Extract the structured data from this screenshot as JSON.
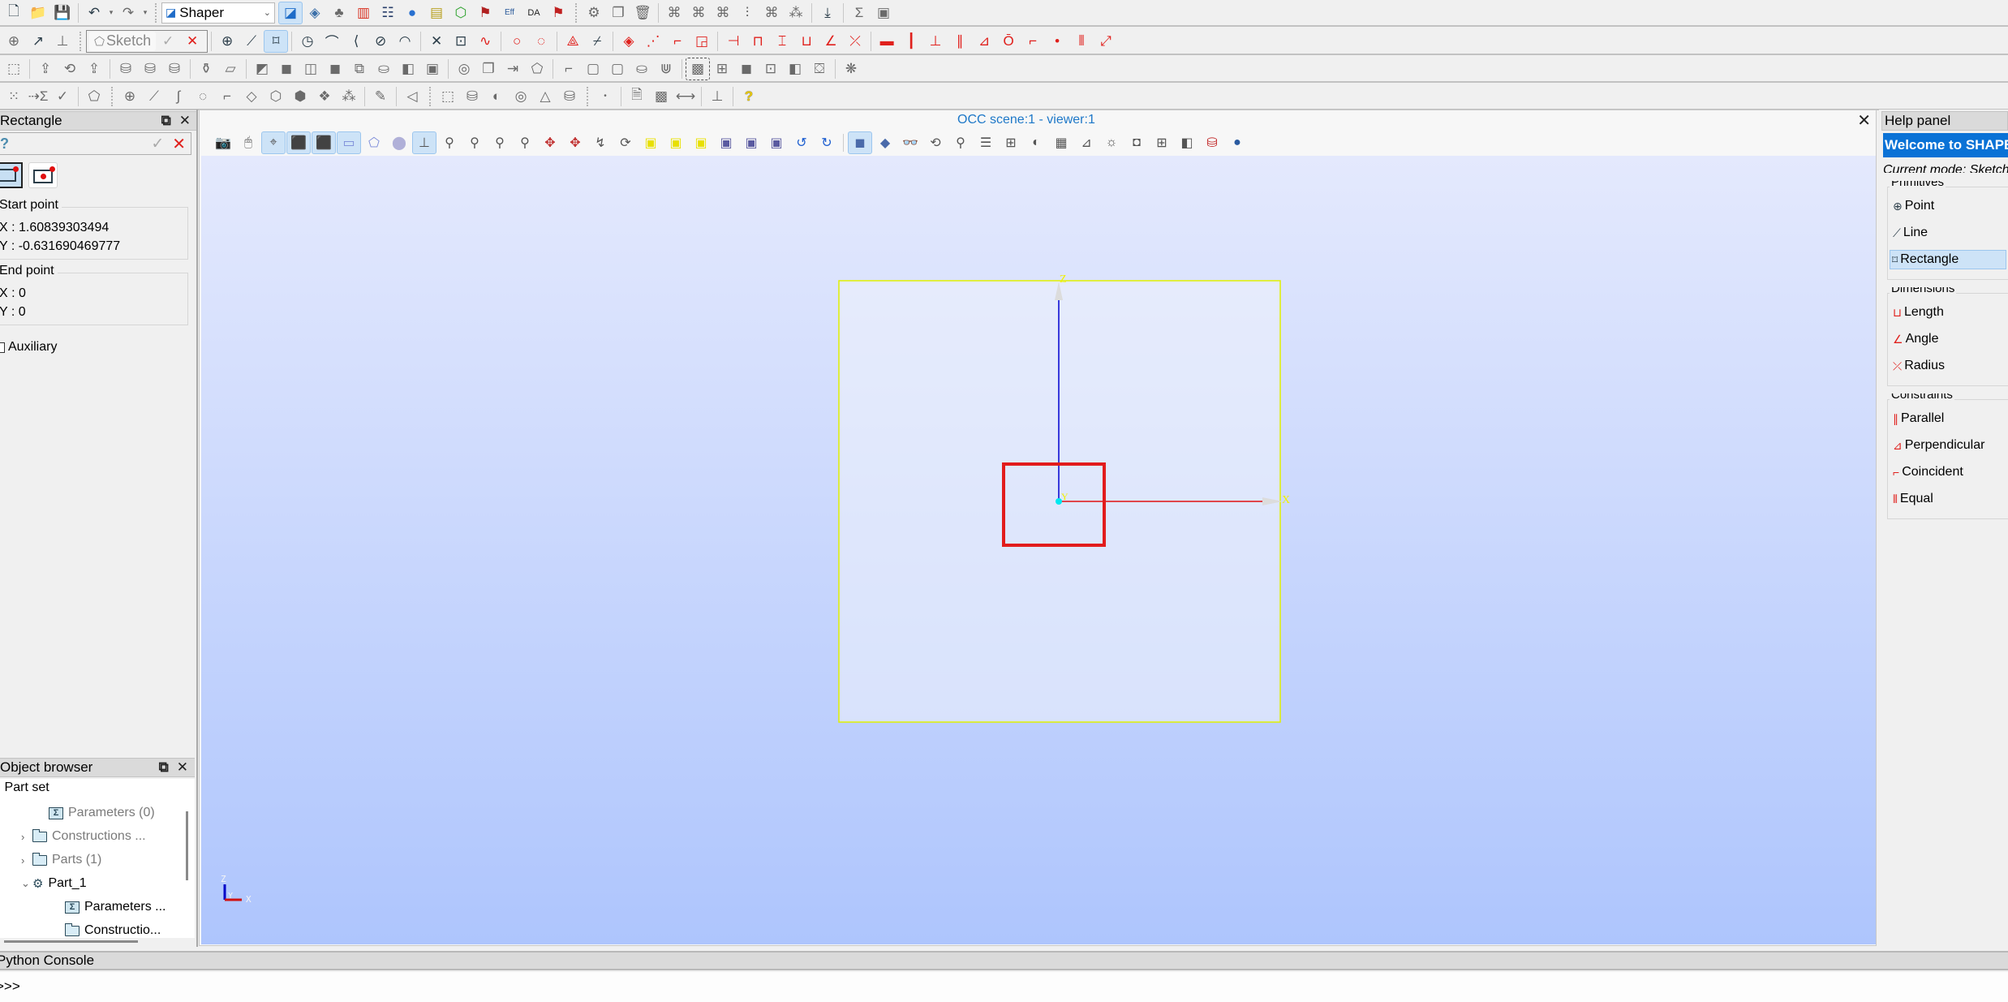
{
  "toolbar": {
    "module_selector": {
      "value": "Shaper",
      "icon": "shaper-module-icon"
    },
    "row1_icons": [
      "new-document-icon",
      "open-folder-icon",
      "save-icon",
      "undo-icon",
      "undo-dropdown-icon",
      "redo-icon",
      "redo-dropdown-icon"
    ],
    "row1_module_icons": [
      "shaper-icon",
      "geometry-icon",
      "mesh-icon",
      "post-pro-icon",
      "yacs-icon",
      "jobmanager-icon",
      "paravis-icon",
      "hexablock-icon",
      "homard-icon",
      "efficas-icon",
      "adao-icon",
      "hydro-icon"
    ],
    "row1_tail_icons": [
      "parameters-icon",
      "copy-icon",
      "delete-icon",
      "group-icon",
      "group-add-icon",
      "group-intersect-icon",
      "group-shape-icon",
      "group-substract-icon",
      "group-shape-remove-icon",
      "import-icon",
      "sum-icon",
      "table-sum-icon"
    ],
    "sketch": {
      "label": "Sketch"
    },
    "row2_icons": [
      "point-icon",
      "line-icon",
      "rectangle-icon",
      "circle-icon",
      "arc-icon",
      "ellipse-arc-icon",
      "ellipse-icon",
      "elliptic-arc-icon",
      "split-icon",
      "trim-icon",
      "spline-icon",
      "circle-constr-icon",
      "dashed-circle-icon",
      "projection-icon",
      "intersection-icon",
      "mirror-icon",
      "angle-rotate-icon",
      "fillet-icon",
      "offset-icon",
      "horizontal-distance-icon",
      "vertical-distance-icon",
      "vertical-dim-icon",
      "length-dim-icon",
      "angle-dim-icon",
      "radius-dim-icon",
      "horizontal-icon",
      "vertical-icon",
      "fixed-icon",
      "parallel-icon",
      "perpendicular-icon",
      "tangent-icon",
      "coincident-icon",
      "midpoint-icon",
      "equal-icon",
      "collinear-icon"
    ],
    "row3_icons": [
      "extrusion-cut-icon",
      "extrusion-icon",
      "revolution-icon",
      "extrusion-fuse-icon",
      "pipe-icon",
      "loft-icon",
      "revolution-cut-icon",
      "placement-icon",
      "translation-icon",
      "cut-icon",
      "fuse-icon",
      "common-icon",
      "fill-icon",
      "intersect-icon",
      "smash-icon",
      "split-icon",
      "partition-icon",
      "union-icon",
      "remove-sub-icon",
      "recover-icon",
      "shell-icon",
      "box-icon",
      "cylinder-icon",
      "sphere-icon",
      "cone-icon",
      "torus-icon",
      "chamfer-icon"
    ],
    "row4_icons": [
      "point-cloud-icon",
      "sigma-icon",
      "check-icon",
      "polyline-icon",
      "vertex-icon",
      "edge-icon",
      "wire-icon",
      "face-icon",
      "shell-build-icon",
      "solid-icon",
      "compsolid-icon",
      "compound-icon",
      "interpolation-icon",
      "filling-icon",
      "box-prim-icon",
      "cylinder-prim-icon",
      "sphere-prim-icon",
      "torus-prim-icon",
      "cone-prim-icon",
      "tube-icon",
      "dot-icon",
      "export-icon",
      "material-icon",
      "measurement-icon",
      "plane-icon",
      "help-icon"
    ]
  },
  "property_panel": {
    "title": "Rectangle",
    "type_options": [
      "by-corners",
      "by-center"
    ],
    "start_point": {
      "title": "Start point",
      "x_label": "X : 1.60839303494",
      "y_label": "Y : -0.631690469777"
    },
    "end_point": {
      "title": "End point",
      "x_label": "X : 0",
      "y_label": "Y : 0"
    },
    "auxiliary": {
      "label": "Auxiliary",
      "checked": false
    }
  },
  "object_browser": {
    "title": "Object browser",
    "items": [
      {
        "label": "Part set",
        "icon": "partset-icon",
        "expander": "",
        "muted": false
      },
      {
        "label": "Parameters (0)",
        "icon": "parameters-icon",
        "expander": "",
        "muted": true
      },
      {
        "label": "Constructions ...",
        "icon": "folder-icon",
        "expander": "›",
        "muted": true
      },
      {
        "label": "Parts (1)",
        "icon": "folder-icon",
        "expander": "›",
        "muted": true
      },
      {
        "label": "Part_1",
        "icon": "part-gear-icon",
        "expander": "⌄",
        "muted": false
      },
      {
        "label": "Parameters ...",
        "icon": "parameters-icon",
        "expander": "",
        "muted": false
      },
      {
        "label": "Constructio...",
        "icon": "folder-icon",
        "expander": "",
        "muted": false
      }
    ]
  },
  "viewer": {
    "title": "OCC scene:1 - viewer:1",
    "title_color": "#1e78c8",
    "toolbar_icons": [
      "dump-view-icon",
      "interaction-style-icon",
      "zooming-style-icon",
      "preselection-icon",
      "selection-icon",
      "rectangle-selection-icon",
      "polygon-selection-icon",
      "circle-selection-icon",
      "trihedron-icon",
      "fit-all-icon",
      "fit-area-icon",
      "fit-selection-icon",
      "zoom-icon",
      "pan-icon",
      "global-pan-icon",
      "rotation-point-icon",
      "rotate-icon",
      "front-view-icon",
      "back-view-icon",
      "top-view-icon",
      "bottom-view-icon",
      "left-view-icon",
      "right-view-icon",
      "anticlockwise-icon",
      "clockwise-icon",
      "orthographic-icon",
      "perspective-icon",
      "stereo-icon",
      "reset-icon",
      "memorize-view-icon",
      "restore-view-icon",
      "clipping-icon",
      "scaling-icon",
      "graduated-axes-icon",
      "ambient-icon",
      "synchronize-icon",
      "minimize-icon",
      "maximize-icon",
      "environment-icon",
      "ray-tracing-icon",
      "light-source-icon"
    ],
    "scene": {
      "axis_labels": {
        "x": "X",
        "y": "Y",
        "z": "Z"
      },
      "plane_color": "#e0f000",
      "rectangle_color": "#e21c1c",
      "origin_color": "#00e8f0",
      "trihedron": {
        "x": "X",
        "y": "Y",
        "z": "Z"
      }
    }
  },
  "help_panel": {
    "title": "Help panel",
    "welcome": "Welcome to SHAPER",
    "mode": "Current mode: Sketch",
    "groups": [
      {
        "title": "Primitives",
        "items": [
          {
            "label": "Point",
            "icon": "point-icon",
            "selected": false
          },
          {
            "label": "Line",
            "icon": "line-icon",
            "selected": false
          },
          {
            "label": "Rectangle",
            "icon": "rectangle-icon",
            "selected": true
          }
        ]
      },
      {
        "title": "Dimensions",
        "items": [
          {
            "label": "Length",
            "icon": "length-icon",
            "selected": false
          },
          {
            "label": "Angle",
            "icon": "angle-icon",
            "selected": false
          },
          {
            "label": "Radius",
            "icon": "radius-icon",
            "selected": false
          }
        ]
      },
      {
        "title": "Constraints",
        "items": [
          {
            "label": "Parallel",
            "icon": "parallel-icon",
            "selected": false
          },
          {
            "label": "Perpendicular",
            "icon": "perpendicular-icon",
            "selected": false
          },
          {
            "label": "Coincident",
            "icon": "coincident-icon",
            "selected": false
          },
          {
            "label": "Equal",
            "icon": "equal-icon",
            "selected": false
          }
        ]
      }
    ]
  },
  "python_console": {
    "title": "Python Console",
    "prompt": ">>>"
  }
}
